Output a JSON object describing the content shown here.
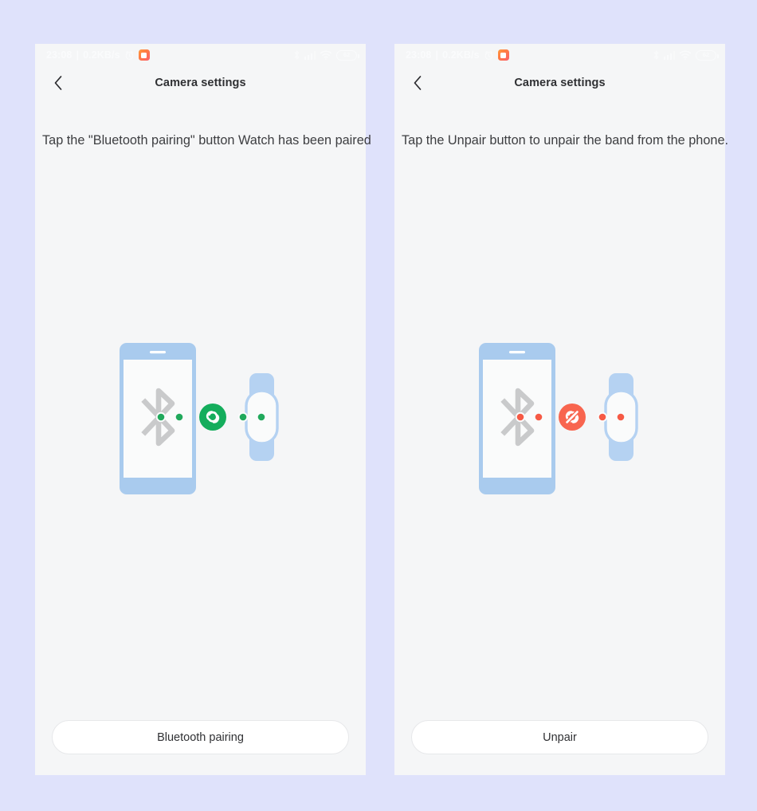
{
  "page": {
    "background_color": "#dfe2fb",
    "panel_background": "#f5f6f7"
  },
  "status_bar": {
    "time": "23:08",
    "separator": "|",
    "network_speed": "0.2KB/s",
    "alarm_icon": "alarm-clock-icon",
    "app_icon": "mi-fit-app-icon",
    "bluetooth_icon": "bluetooth-icon",
    "signal_icon": "cellular-signal-icon",
    "wifi_icon": "wifi-icon",
    "battery_icon": "battery-icon",
    "battery_level": "62"
  },
  "panels": [
    {
      "id": "paired-panel",
      "app_bar": {
        "back_icon": "chevron-left-icon",
        "title": "Camera settings"
      },
      "hint_text": "Tap the \"Bluetooth pairing\" button Watch has been paired",
      "illustration": {
        "name": "phone-band-pairing-illustration",
        "state": "connected",
        "phone_color": "#a9cbee",
        "phone_screen_color": "#fafbfb",
        "bluetooth_glyph_color": "#c9cacb",
        "band_color": "#b5d2f2",
        "badge_color": "#14ad5c",
        "badge_icon": "link-connected-icon",
        "dot_color": "#21a95c"
      },
      "action_button": {
        "label": "Bluetooth pairing",
        "name": "bluetooth-pairing-button"
      }
    },
    {
      "id": "unpair-panel",
      "app_bar": {
        "back_icon": "chevron-left-icon",
        "title": "Camera settings"
      },
      "hint_text": "Tap the Unpair button to unpair the band from the phone.",
      "illustration": {
        "name": "phone-band-unpair-illustration",
        "state": "disconnected",
        "phone_color": "#a9cbee",
        "phone_screen_color": "#fafbfb",
        "bluetooth_glyph_color": "#c9cacb",
        "band_color": "#b5d2f2",
        "badge_color": "#f8654f",
        "badge_icon": "link-broken-icon",
        "dot_color": "#f65a45"
      },
      "action_button": {
        "label": "Unpair",
        "name": "unpair-button"
      }
    }
  ]
}
